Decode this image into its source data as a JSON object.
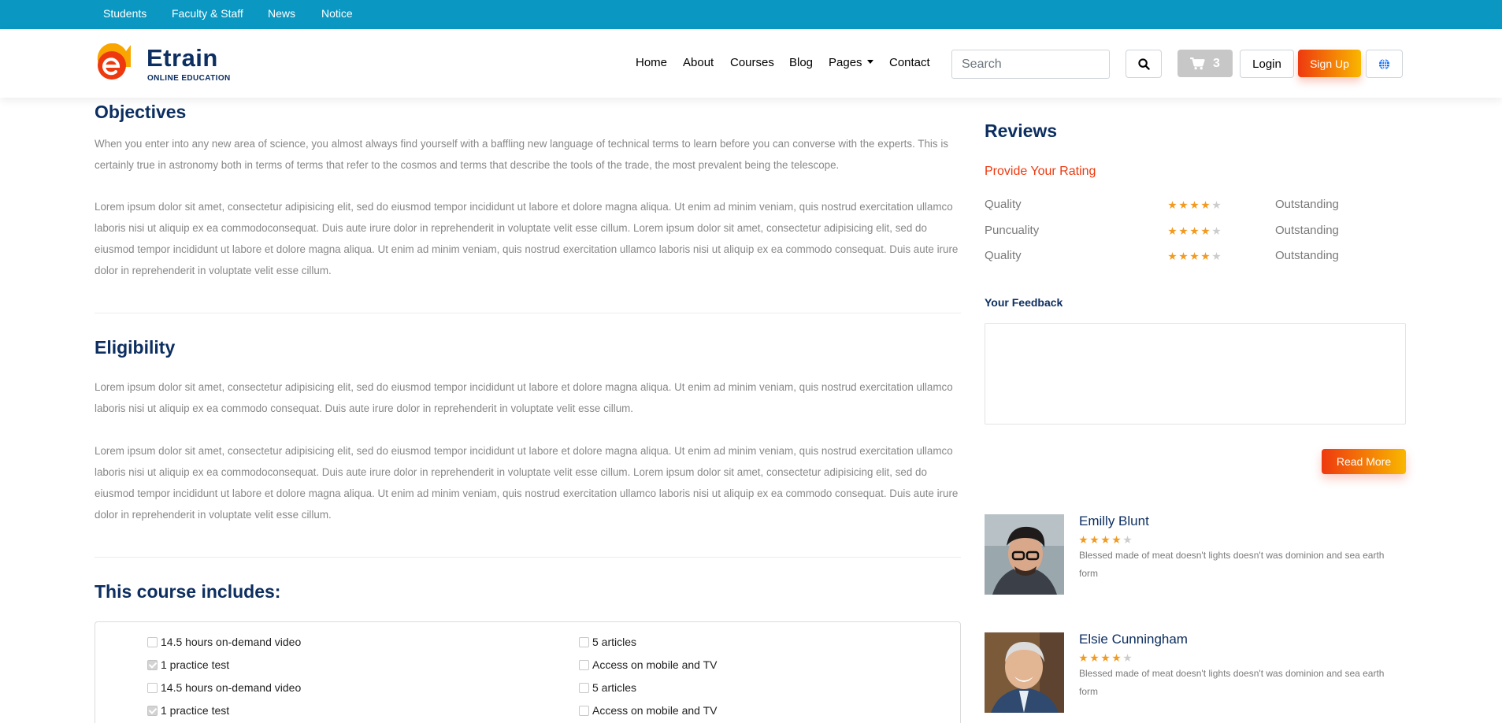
{
  "topbar": {
    "links": [
      "Students",
      "Faculty & Staff",
      "News",
      "Notice"
    ],
    "color": "#0a97c2"
  },
  "brand": {
    "name": "Etrain",
    "tagline": "ONLINE EDUCATION",
    "icon": "etrain-logo-icon"
  },
  "nav": {
    "items": [
      "Home",
      "About",
      "Courses",
      "Blog",
      "Pages",
      "Contact"
    ],
    "search_placeholder": "Search",
    "cart_count": "3",
    "login_label": "Login",
    "signup_label": "Sign Up",
    "icons": [
      "search-icon",
      "cart-icon",
      "globe-icon"
    ]
  },
  "objectives": {
    "title": "Objectives",
    "paragraphs": [
      "When you enter into any new area of science, you almost always find yourself with a baffling new language of technical terms to learn before you can converse with the experts. This is certainly true in astronomy both in terms of terms that refer to the cosmos and terms that describe the tools of the trade, the most prevalent being the telescope.",
      "Lorem ipsum dolor sit amet, consectetur adipisicing elit, sed do eiusmod tempor incididunt ut labore et dolore magna aliqua. Ut enim ad minim veniam, quis nostrud exercitation ullamco laboris nisi ut aliquip ex ea commodoconsequat. Duis aute irure dolor in reprehenderit in voluptate velit esse cillum. Lorem ipsum dolor sit amet, consectetur adipisicing elit, sed do eiusmod tempor incididunt ut labore et dolore magna aliqua. Ut enim ad minim veniam, quis nostrud exercitation ullamco laboris nisi ut aliquip ex ea commodo consequat. Duis aute irure dolor in reprehenderit in voluptate velit esse cillum."
    ]
  },
  "eligibility": {
    "title": "Eligibility",
    "paragraphs": [
      "Lorem ipsum dolor sit amet, consectetur adipisicing elit, sed do eiusmod tempor incididunt ut labore et dolore magna aliqua. Ut enim ad minim veniam, quis nostrud exercitation ullamco laboris nisi ut aliquip ex ea commodo consequat. Duis aute irure dolor in reprehenderit in voluptate velit esse cillum.",
      "Lorem ipsum dolor sit amet, consectetur adipisicing elit, sed do eiusmod tempor incididunt ut labore et dolore magna aliqua. Ut enim ad minim veniam, quis nostrud exercitation ullamco laboris nisi ut aliquip ex ea commodoconsequat. Duis aute irure dolor in reprehenderit in voluptate velit esse cillum. Lorem ipsum dolor sit amet, consectetur adipisicing elit, sed do eiusmod tempor incididunt ut labore et dolore magna aliqua. Ut enim ad minim veniam, quis nostrud exercitation ullamco laboris nisi ut aliquip ex ea commodo consequat. Duis aute irure dolor in reprehenderit in voluptate velit esse cillum."
    ]
  },
  "includes": {
    "title": "This course includes:",
    "left": [
      {
        "label": "14.5 hours on-demand video",
        "checked": false
      },
      {
        "label": "1 practice test",
        "checked": true
      },
      {
        "label": "14.5 hours on-demand video",
        "checked": false
      },
      {
        "label": "1 practice test",
        "checked": true
      }
    ],
    "right": [
      {
        "label": "5 articles",
        "checked": false
      },
      {
        "label": "Access on mobile and TV",
        "checked": false
      },
      {
        "label": "5 articles",
        "checked": false
      },
      {
        "label": "Access on mobile and TV",
        "checked": false
      }
    ]
  },
  "reviews": {
    "title": "Reviews",
    "rating_title": "Provide Your Rating",
    "ratings": [
      {
        "name": "Quality",
        "stars": 4,
        "value": "Outstanding"
      },
      {
        "name": "Puncuality",
        "stars": 4,
        "value": "Outstanding"
      },
      {
        "name": "Quality",
        "stars": 4,
        "value": "Outstanding"
      }
    ],
    "feedback_label": "Your Feedback",
    "feedback_value": "",
    "read_more_label": "Read More",
    "items": [
      {
        "name": "Emilly Blunt",
        "stars": 4,
        "text": "Blessed made of meat doesn't lights doesn't was dominion and sea earth form"
      },
      {
        "name": "Elsie Cunningham",
        "stars": 4,
        "text": "Blessed made of meat doesn't lights doesn't was dominion and sea earth form"
      }
    ]
  },
  "colors": {
    "accent": "#ee390f",
    "accent_end": "#f9b700",
    "navy": "#0c2e60",
    "star": "#f29a1f"
  }
}
